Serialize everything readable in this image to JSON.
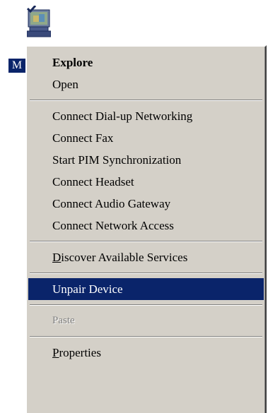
{
  "desktop": {
    "icon_label_fragment": "M"
  },
  "context_menu": {
    "explore": "Explore",
    "open": "Open",
    "connect_dialup": "Connect Dial-up Networking",
    "connect_fax": "Connect Fax",
    "start_pim": "Start PIM Synchronization",
    "connect_headset": "Connect Headset",
    "connect_audio_gateway": "Connect Audio Gateway",
    "connect_network_access": "Connect Network Access",
    "discover_first": "D",
    "discover_rest": "iscover Available Services",
    "unpair_device": "Unpair Device",
    "paste": "Paste",
    "properties_first": "P",
    "properties_rest": "roperties"
  },
  "colors": {
    "menu_background": "#d4d0c8",
    "highlight": "#0a246a",
    "disabled_text": "#808080"
  }
}
